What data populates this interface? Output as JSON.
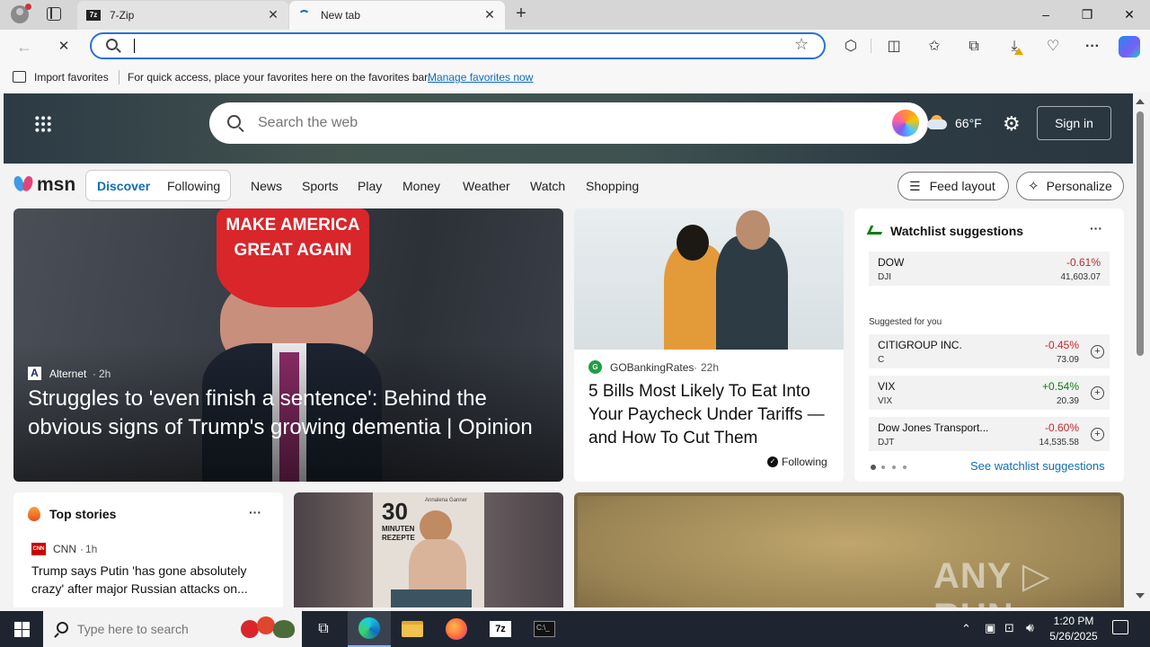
{
  "browser": {
    "tabs": [
      {
        "title": "7-Zip",
        "active": false
      },
      {
        "title": "New tab",
        "active": true
      }
    ],
    "window_controls": {
      "minimize": "–",
      "restore": "❐",
      "close": "✕"
    },
    "address": {
      "value": "",
      "placeholder": ""
    },
    "favorites_bar": {
      "import_label": "Import favorites",
      "message": "For quick access, place your favorites here on the favorites bar.",
      "manage_link": "Manage favorites now"
    }
  },
  "msn": {
    "search_placeholder": "Search the web",
    "weather": {
      "temp": "66°F"
    },
    "sign_in": "Sign in",
    "logo_text": "msn",
    "feed_tabs": [
      {
        "label": "Discover",
        "active": true
      },
      {
        "label": "Following",
        "active": false
      }
    ],
    "nav": [
      "News",
      "Sports",
      "Play",
      "Money",
      "Weather",
      "Watch",
      "Shopping"
    ],
    "feed_layout": "Feed layout",
    "personalize": "Personalize",
    "hero_article": {
      "source": "Alternet",
      "age": "2h",
      "headline": "Struggles to 'even finish a sentence': Behind the obvious signs of Trump's growing dementia | Opinion",
      "hat_line1": "MAKE AMERICA",
      "hat_line2": "GREAT AGAIN"
    },
    "second_article": {
      "source": "GOBankingRates",
      "age": "22h",
      "headline": "5 Bills Most Likely To Eat Into Your Paycheck Under Tariffs — and How To Cut Them",
      "following": "Following"
    },
    "watchlist": {
      "title": "Watchlist suggestions",
      "more": "···",
      "main": {
        "name": "DOW",
        "symbol": "DJI",
        "change": "-0.61%",
        "price": "41,603.07"
      },
      "suggested_label": "Suggested for you",
      "suggestions": [
        {
          "name": "CITIGROUP INC.",
          "symbol": "C",
          "change": "-0.45%",
          "price": "73.09"
        },
        {
          "name": "VIX",
          "symbol": "VIX",
          "change": "+0.54%",
          "price": "20.39"
        },
        {
          "name": "Dow Jones Transport...",
          "symbol": "DJT",
          "change": "-0.60%",
          "price": "14,535.58"
        }
      ],
      "see_link": "See watchlist suggestions"
    },
    "top_stories": {
      "title": "Top stories",
      "more": "···",
      "source": "CNN",
      "age": "1h",
      "headline": "Trump says Putin 'has gone absolutely crazy' after major Russian attacks on..."
    },
    "book_card": {
      "number": "30",
      "line1": "MINUTEN",
      "line2": "REZEPTE",
      "author": "Annalena Ganner"
    }
  },
  "taskbar": {
    "search_placeholder": "Type here to search",
    "time": "1:20 PM",
    "date": "5/26/2025"
  },
  "colors": {
    "accent": "#0f6cbd",
    "negative": "#c4262e",
    "positive": "#107c10",
    "address_border": "#2a6fdb"
  }
}
